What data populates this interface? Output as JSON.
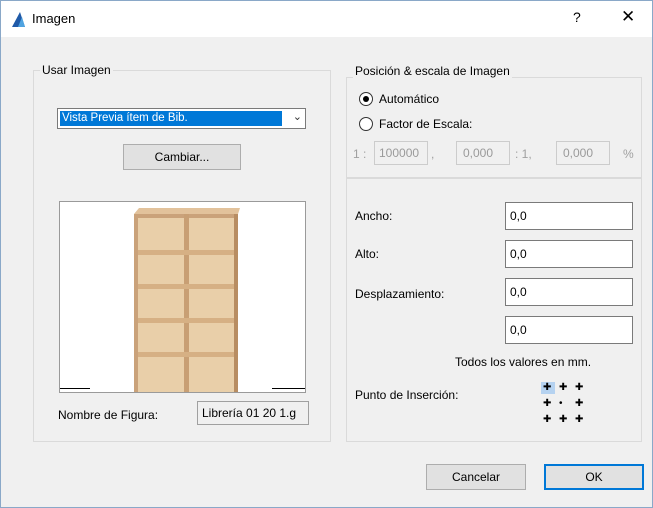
{
  "window": {
    "title": "Imagen",
    "help": "?",
    "close": "✕"
  },
  "usar_imagen": {
    "label": "Usar Imagen",
    "source_value": "Vista Previa ítem de Bib.",
    "change_button": "Cambiar...",
    "figure_name_label": "Nombre de Figura:",
    "figure_name_value": "Librería 01 20 1.g"
  },
  "posicion": {
    "label": "Posición & escala de Imagen",
    "auto_label": "Automático",
    "factor_label": "Factor de Escala:",
    "scale_prefix": "1 :",
    "scale_value": "100000",
    "comma": ",",
    "value1": "0,000",
    "ratio": ": 1,",
    "value2": "0,000",
    "percent": "%"
  },
  "dims": {
    "ancho_label": "Ancho:",
    "ancho_value": "0,0",
    "alto_label": "Alto:",
    "alto_value": "0,0",
    "desplaz_label": "Desplazamiento:",
    "desplaz_value": "0,0",
    "extra_value": "0,0",
    "note": "Todos los valores en mm.",
    "insertion_label": "Punto de Inserción:"
  },
  "footer": {
    "cancel": "Cancelar",
    "ok": "OK"
  },
  "colors": {
    "accent": "#0078d7",
    "shelf": "#d9b48a"
  }
}
